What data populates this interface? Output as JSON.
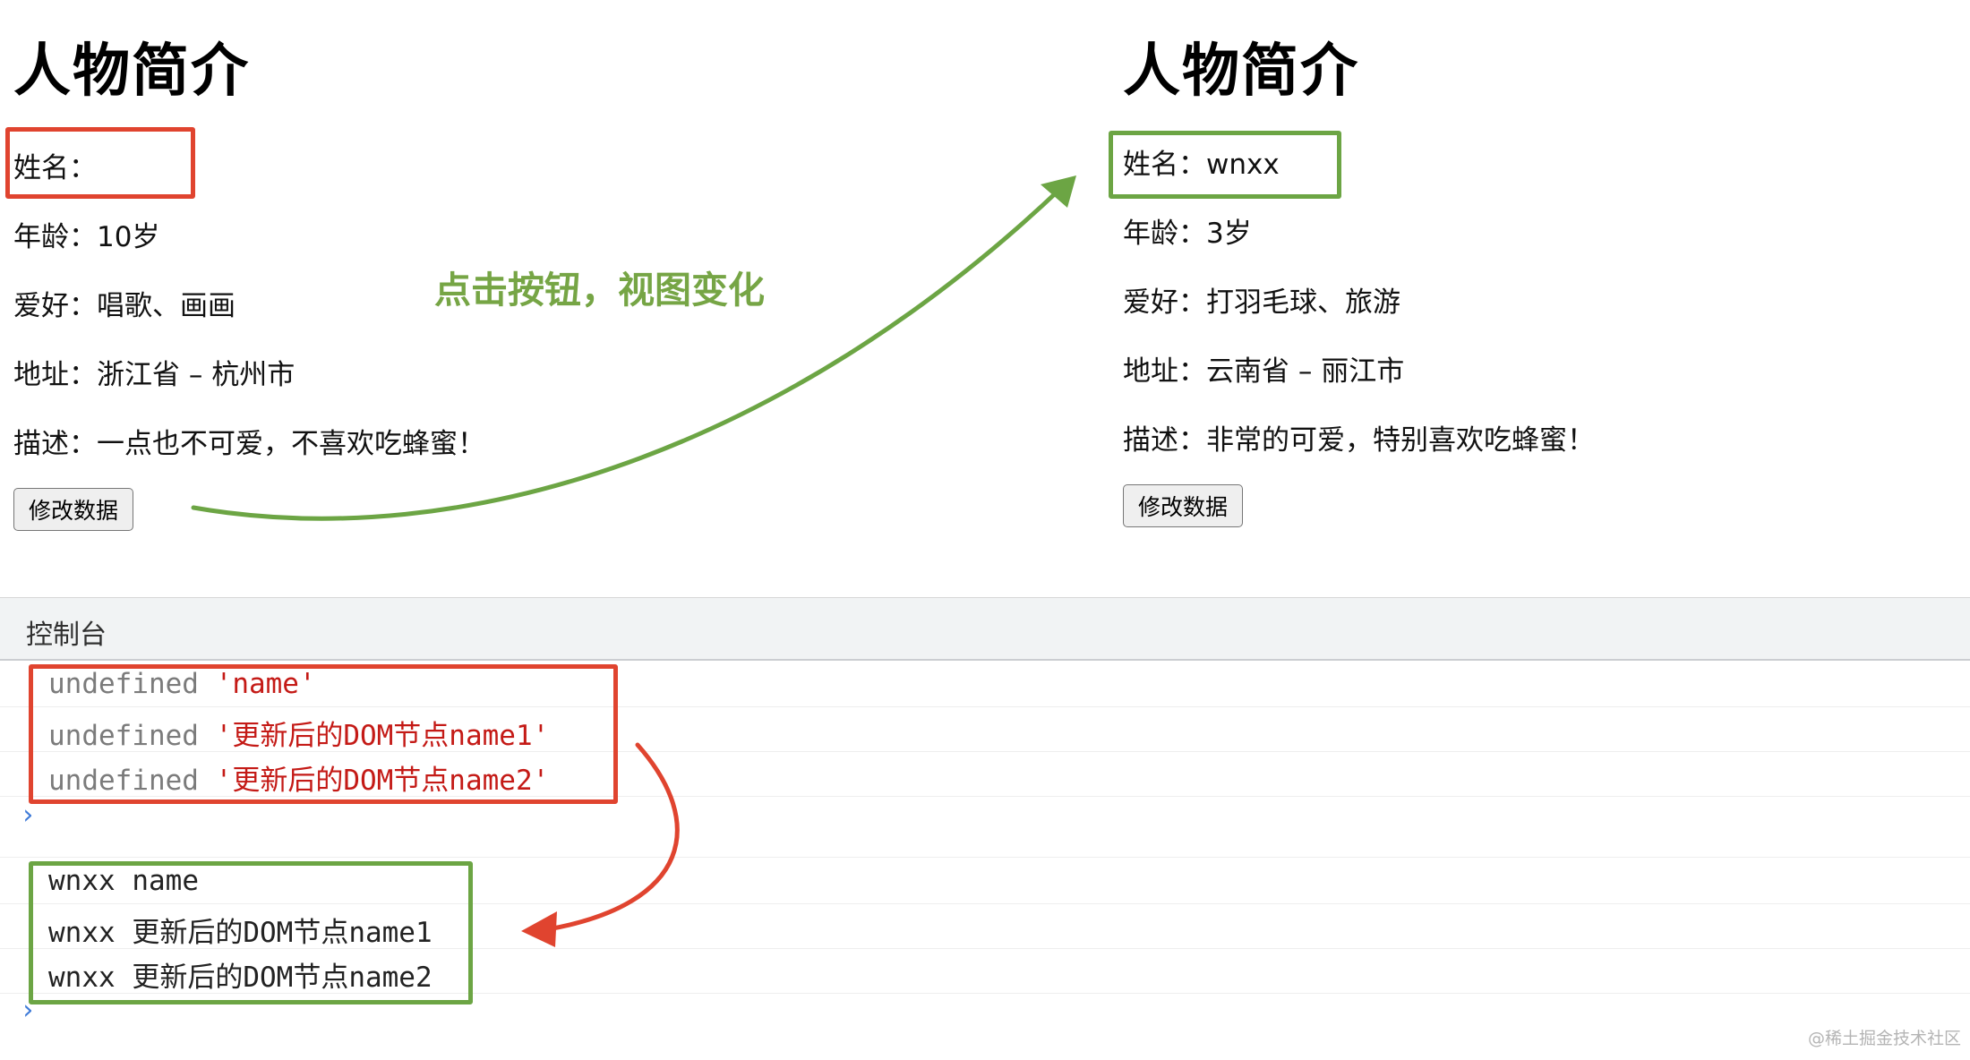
{
  "before": {
    "title": "人物简介",
    "rows": [
      {
        "label": "姓名：",
        "value": ""
      },
      {
        "label": "年龄：",
        "value": "10岁"
      },
      {
        "label": "爱好：",
        "value": "唱歌、画画"
      },
      {
        "label": "地址：",
        "value": "浙江省 – 杭州市"
      },
      {
        "label": "描述：",
        "value": "一点也不可爱，不喜欢吃蜂蜜！"
      }
    ],
    "button_label": "修改数据"
  },
  "after": {
    "title": "人物简介",
    "rows": [
      {
        "label": "姓名：",
        "value": "wnxx"
      },
      {
        "label": "年龄：",
        "value": "3岁"
      },
      {
        "label": "爱好：",
        "value": "打羽毛球、旅游"
      },
      {
        "label": "地址：",
        "value": "云南省 – 丽江市"
      },
      {
        "label": "描述：",
        "value": "非常的可爱，特别喜欢吃蜂蜜！"
      }
    ],
    "button_label": "修改数据"
  },
  "annotation": "点击按钮，视图变化",
  "console": {
    "header": "控制台",
    "before_lines": [
      {
        "prefix": "undefined",
        "value": "'name'"
      },
      {
        "prefix": "undefined",
        "value": "'更新后的DOM节点name1'"
      },
      {
        "prefix": "undefined",
        "value": "'更新后的DOM节点name2'"
      }
    ],
    "after_lines": [
      {
        "prefix": "wnxx",
        "value": "name"
      },
      {
        "prefix": "wnxx",
        "value": "更新后的DOM节点name1"
      },
      {
        "prefix": "wnxx",
        "value": "更新后的DOM节点name2"
      }
    ],
    "prompt_symbol": "›"
  },
  "watermark": "@稀土掘金技术社区",
  "colors": {
    "highlight_red": "#e0442f",
    "highlight_green": "#6ca544",
    "annotation_green": "#76a545",
    "console_string": "#c41a16",
    "console_undefined": "#7b7b7b",
    "prompt_blue": "#3f7bd8"
  }
}
